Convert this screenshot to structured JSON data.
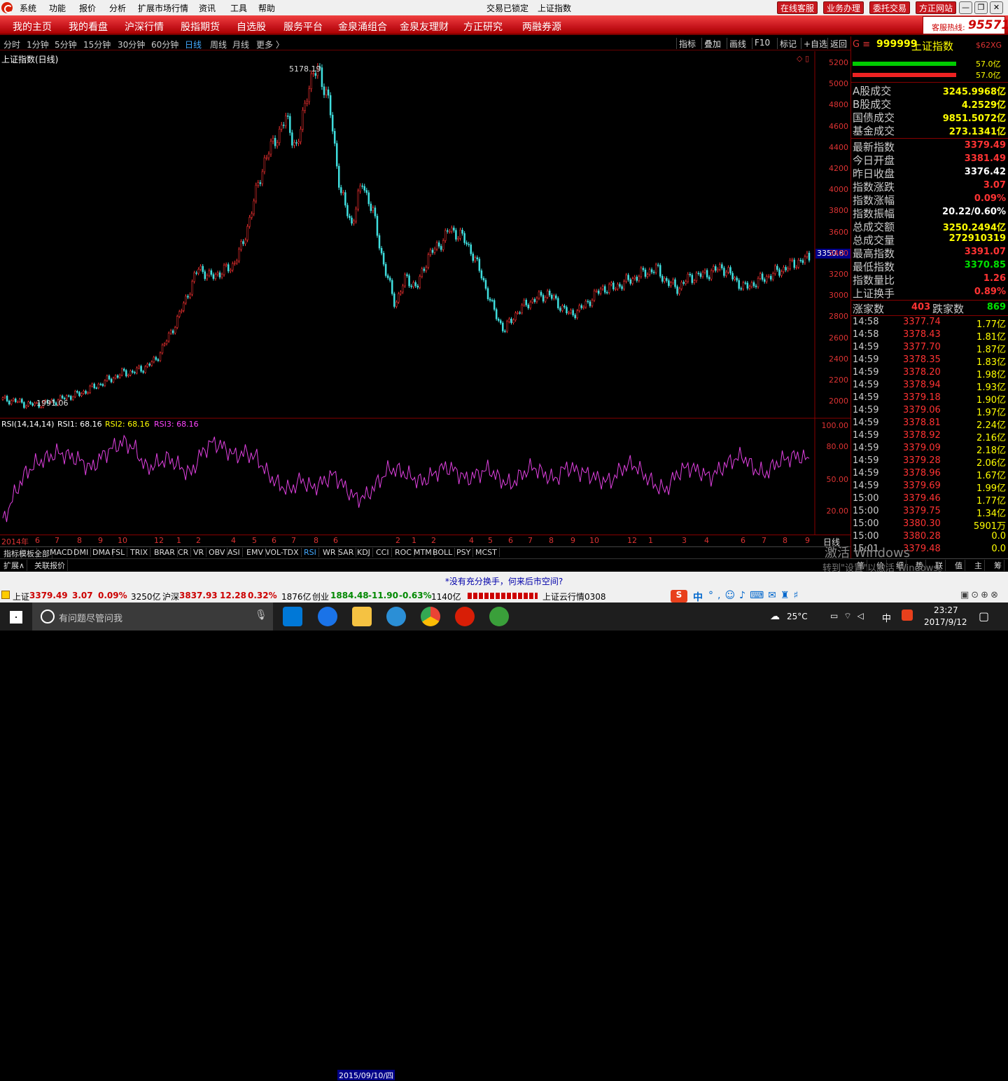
{
  "titlebar": {
    "menus": [
      "系统",
      "功能",
      "报价",
      "分析",
      "扩展市场行情",
      "资讯",
      "工具",
      "帮助"
    ],
    "status": "交易已锁定",
    "title": "上证指数",
    "buttons": [
      "在线客服",
      "业务办理",
      "委托交易",
      "方正网站"
    ],
    "win": [
      "—",
      "❐",
      "✕"
    ]
  },
  "nav": {
    "items": [
      "我的主页",
      "我的看盘",
      "沪深行情",
      "股指期货",
      "自选股",
      "服务平台",
      "金泉涌组合",
      "金泉友理财",
      "方正研究",
      "两融券源"
    ],
    "hotline_label": "客服热线:",
    "hotline_num": "95571"
  },
  "periods": {
    "items": [
      "分时",
      "1分钟",
      "5分钟",
      "15分钟",
      "30分钟",
      "60分钟",
      "日线",
      "周线",
      "月线",
      "更多 〉"
    ],
    "active": 6,
    "tools": [
      "指标",
      "叠加",
      "画线",
      "F10",
      "标记",
      "+自选",
      "返回"
    ]
  },
  "chart": {
    "label": "上证指数(日线)",
    "high_label": "5178.19",
    "low_label": "1991.06",
    "cursor_value": "3350.8",
    "yticks": [
      "5200",
      "5000",
      "4800",
      "4600",
      "4400",
      "4200",
      "4000",
      "3800",
      "3600",
      "3400",
      "3200",
      "3000",
      "2800",
      "2600",
      "2400",
      "2200",
      "2000"
    ]
  },
  "rsi": {
    "label": "RSI(14,14,14)",
    "r1": "RSI1: 68.16",
    "r2": "RSI2: 68.16",
    "r3": "RSI3: 68.16",
    "yticks": [
      "100.00",
      "80.00",
      "50.00",
      "20.00"
    ]
  },
  "xaxis": {
    "labels": [
      "2014年",
      "6",
      "7",
      "8",
      "9",
      "10",
      "12",
      "1",
      "2",
      "4",
      "5",
      "6",
      "7",
      "8",
      "6",
      "2",
      "1",
      "2",
      "4",
      "5",
      "6",
      "7",
      "8",
      "9",
      "10",
      "12",
      "1",
      "3",
      "4",
      "6",
      "7",
      "8",
      "9"
    ],
    "cursor": "2015/09/10/四",
    "right": "日线"
  },
  "tabs1": [
    "指标",
    "模板",
    "全部",
    "MACD",
    "DMI",
    "DMA",
    "FSL",
    "TRIX",
    "BRAR",
    "CR",
    "VR",
    "OBV",
    "ASI",
    "EMV",
    "VOL-TDX",
    "RSI",
    "WR",
    "SAR",
    "KDJ",
    "CCI",
    "ROC",
    "MTM",
    "BOLL",
    "PSY",
    "MCST"
  ],
  "tabs2": [
    "扩展∧",
    "关联报价"
  ],
  "panel": {
    "code": "999999",
    "name": "上证指数",
    "tag": "$62XG",
    "bars": [
      "57.0亿",
      "57.0亿"
    ],
    "turnover": [
      {
        "l": "A股成交",
        "v": "3245.9968亿"
      },
      {
        "l": "B股成交",
        "v": "4.2529亿"
      },
      {
        "l": "国债成交",
        "v": "9851.5072亿"
      },
      {
        "l": "基金成交",
        "v": "273.1341亿"
      }
    ],
    "stats": [
      {
        "l": "最新指数",
        "v": "3379.49",
        "c": "red"
      },
      {
        "l": "今日开盘",
        "v": "3381.49",
        "c": "red"
      },
      {
        "l": "昨日收盘",
        "v": "3376.42",
        "c": "white"
      },
      {
        "l": "指数涨跌",
        "v": "3.07",
        "c": "red"
      },
      {
        "l": "指数涨幅",
        "v": "0.09%",
        "c": "red"
      },
      {
        "l": "指数振幅",
        "v": "20.22/0.60%",
        "c": "white"
      },
      {
        "l": "总成交额",
        "v": "3250.2494亿",
        "c": "yellow"
      },
      {
        "l": "总成交量",
        "v": "272910319",
        "c": "yellow"
      },
      {
        "l": "最高指数",
        "v": "3391.07",
        "c": "red"
      },
      {
        "l": "最低指数",
        "v": "3370.85",
        "c": "green"
      },
      {
        "l": "指数量比",
        "v": "1.26",
        "c": "red"
      },
      {
        "l": "上证换手",
        "v": "0.89%",
        "c": "red"
      }
    ],
    "updown": {
      "up_label": "涨家数",
      "up": "403",
      "down_label": "跌家数",
      "down": "869"
    },
    "ticks": [
      [
        "14:58",
        "3377.74",
        "1.77亿"
      ],
      [
        "14:58",
        "3378.43",
        "1.81亿"
      ],
      [
        "14:59",
        "3377.70",
        "1.87亿"
      ],
      [
        "14:59",
        "3378.35",
        "1.83亿"
      ],
      [
        "14:59",
        "3378.20",
        "1.98亿"
      ],
      [
        "14:59",
        "3378.94",
        "1.93亿"
      ],
      [
        "14:59",
        "3379.18",
        "1.90亿"
      ],
      [
        "14:59",
        "3379.06",
        "1.97亿"
      ],
      [
        "14:59",
        "3378.81",
        "2.24亿"
      ],
      [
        "14:59",
        "3378.92",
        "2.16亿"
      ],
      [
        "14:59",
        "3379.09",
        "2.18亿"
      ],
      [
        "14:59",
        "3379.28",
        "2.06亿"
      ],
      [
        "14:59",
        "3378.96",
        "1.67亿"
      ],
      [
        "14:59",
        "3379.69",
        "1.99亿"
      ],
      [
        "15:00",
        "3379.46",
        "1.77亿"
      ],
      [
        "15:00",
        "3379.75",
        "1.34亿"
      ],
      [
        "15:00",
        "3380.30",
        "5901万"
      ],
      [
        "15:00",
        "3380.28",
        "0.0"
      ],
      [
        "15:01",
        "3379.48",
        "0.0"
      ]
    ],
    "bottom": [
      "笔",
      "价",
      "细",
      "势",
      "联",
      "值",
      "主",
      "筹"
    ]
  },
  "scroll": "*没有充分换手，何来后市空间?",
  "status": {
    "sh_l": "上证",
    "sh_v": "3379.49",
    "sh_c": "3.07",
    "sh_p": "0.09%",
    "sh_a": "3250亿",
    "sz_l": "沪深",
    "sz_v": "3837.93",
    "sz_c": "12.28",
    "sz_p": "0.32%",
    "sz_a": "1876亿",
    "cy_l": "创业",
    "cy_v": "1884.48",
    "cy_c": "-11.90",
    "cy_p": "-0.63%",
    "cy_a": "1140亿",
    "cloud": "上证云行情0308",
    "ime": "中"
  },
  "watermark": {
    "l1": "激活 Windows",
    "l2": "转到\"设置\"以激活 Windows。"
  },
  "taskbar": {
    "search": "有问题尽管问我",
    "temp": "25°C",
    "ime": "中",
    "time": "23:27",
    "date": "2017/9/12"
  },
  "chart_data": {
    "type": "line",
    "note_series": "price",
    "price": [
      2050,
      2040,
      2010,
      2000,
      2020,
      2040,
      2080,
      2100,
      2150,
      2200,
      2250,
      2300,
      2310,
      2350,
      2420,
      2600,
      2800,
      3050,
      3300,
      3200,
      3250,
      3300,
      3500,
      3900,
      4300,
      4500,
      4700,
      4400,
      5000,
      5178,
      4800,
      4000,
      3700,
      4100,
      3800,
      3300,
      2950,
      3200,
      3100,
      3400,
      3500,
      3650,
      3600,
      3450,
      3200,
      2900,
      2700,
      2850,
      2950,
      3000,
      3050,
      2950,
      2850,
      2900,
      3000,
      3100,
      3100,
      3150,
      3200,
      3250,
      3280,
      3150,
      3100,
      3200,
      3220,
      3250,
      3300,
      3200,
      3100,
      3150,
      3200,
      3250,
      3300,
      3350,
      3380
    ],
    "rsi": [
      10,
      35,
      55,
      65,
      70,
      75,
      72,
      68,
      60,
      72,
      80,
      85,
      78,
      60,
      65,
      70,
      62,
      55,
      75,
      85,
      80,
      72,
      75,
      70,
      55,
      45,
      40,
      50,
      42,
      48,
      55,
      42,
      32,
      35,
      48,
      60,
      58,
      52,
      48,
      55,
      62,
      58,
      50,
      55,
      60,
      50,
      45,
      55,
      62,
      55,
      50,
      62,
      58,
      55,
      50,
      48,
      60,
      65,
      55,
      45,
      40,
      55,
      62,
      58,
      52,
      60,
      68,
      72,
      60,
      55,
      65,
      70,
      72,
      68
    ],
    "ylim": [
      1900,
      5300
    ],
    "rsi_ylim": [
      0,
      100
    ]
  }
}
